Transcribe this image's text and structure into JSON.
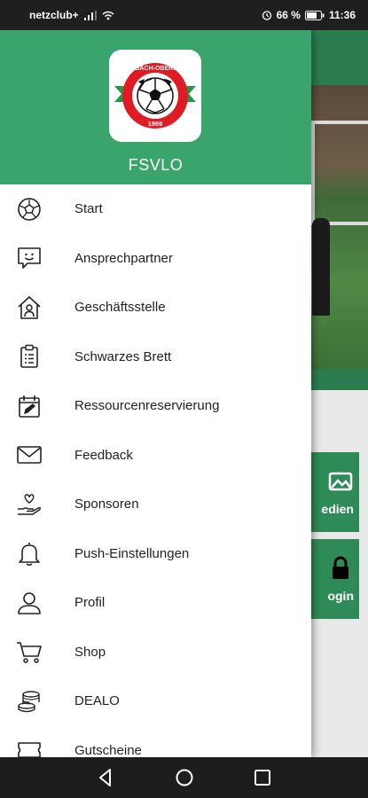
{
  "status_bar": {
    "carrier": "netzclub+",
    "battery": "66 %",
    "time": "11:36"
  },
  "background": {
    "tile1_label": "edien",
    "tile2_label": "ogin"
  },
  "drawer": {
    "club_name": "FSVLO",
    "logo": {
      "top_text": "FSV LIMBACH-OBERFROHNA",
      "year": "1969"
    },
    "items": [
      {
        "label": "Start",
        "icon": "soccer-ball-icon"
      },
      {
        "label": "Ansprechpartner",
        "icon": "chat-smile-icon"
      },
      {
        "label": "Geschäftsstelle",
        "icon": "house-person-icon"
      },
      {
        "label": "Schwarzes Brett",
        "icon": "clipboard-icon"
      },
      {
        "label": "Ressourcenreservierung",
        "icon": "calendar-edit-icon"
      },
      {
        "label": "Feedback",
        "icon": "mail-icon"
      },
      {
        "label": "Sponsoren",
        "icon": "hand-heart-icon"
      },
      {
        "label": "Push-Einstellungen",
        "icon": "bell-icon"
      },
      {
        "label": "Profil",
        "icon": "user-icon"
      },
      {
        "label": "Shop",
        "icon": "cart-icon"
      },
      {
        "label": "DEALO",
        "icon": "coins-icon"
      },
      {
        "label": "Gutscheine",
        "icon": "voucher-icon"
      }
    ]
  },
  "colors": {
    "primary": "#3aa46d",
    "dark_green": "#2b7d4f"
  }
}
